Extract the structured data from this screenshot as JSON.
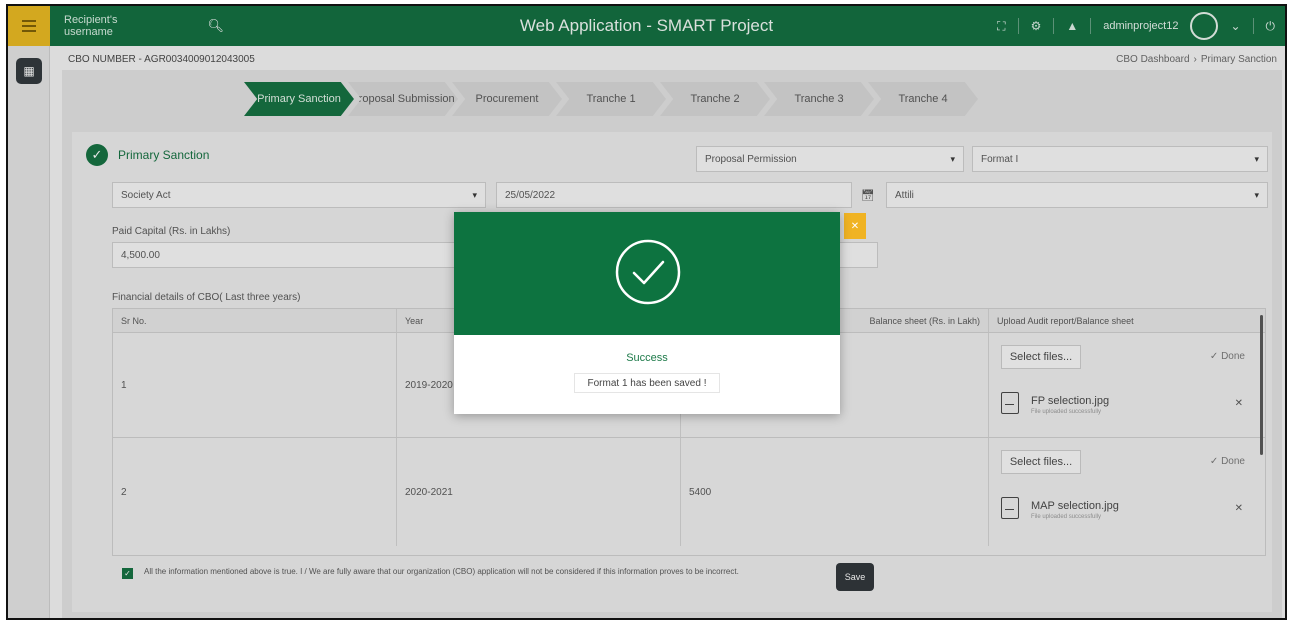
{
  "header": {
    "search_placeholder": "Recipient's username",
    "app_title": "Web Application - SMART Project",
    "username": "adminproject12"
  },
  "subheader": {
    "cbo_number": "CBO NUMBER - AGR0034009012043005",
    "breadcrumb": [
      "CBO Dashboard",
      "Primary Sanction"
    ]
  },
  "steps": [
    "Primary Sanction",
    "Proposal Submission",
    "Procurement",
    "Tranche 1",
    "Tranche 2",
    "Tranche 3",
    "Tranche 4"
  ],
  "form": {
    "section_title": "Primary Sanction",
    "proposal_select": "Proposal Permission",
    "format_select": "Format I",
    "act_select": "Society Act",
    "date_value": "25/05/2022",
    "district_value": "Attili",
    "paid_capital_label": "Paid Capital (Rs. in Lakhs)",
    "paid_capital_value": "4,500.00",
    "financial_label": "Financial details of CBO( Last three years)"
  },
  "table": {
    "headers": [
      "Sr No.",
      "Year",
      "Balance sheet (Rs. in Lakh)",
      "Upload Audit report/Balance sheet"
    ],
    "rows": [
      {
        "sr": "1",
        "year": "2019-2020",
        "balance": "",
        "select": "Select files...",
        "done": "✓ Done",
        "file": "FP selection.jpg",
        "file_sub": "File uploaded successfully"
      },
      {
        "sr": "2",
        "year": "2020-2021",
        "balance": "5400",
        "select": "Select files...",
        "done": "✓ Done",
        "file": "MAP selection.jpg",
        "file_sub": "File uploaded successfully"
      }
    ]
  },
  "declaration": {
    "text": "All the information mentioned above is true. I / We are fully aware that our organization (CBO) application will not be considered if this information proves to be incorrect.",
    "save_label": "Save"
  },
  "modal": {
    "title": "Success",
    "message": "Format 1 has been saved !"
  },
  "colors": {
    "brand_green": "#0d6b3c",
    "accent_yellow": "#e9b81c"
  }
}
